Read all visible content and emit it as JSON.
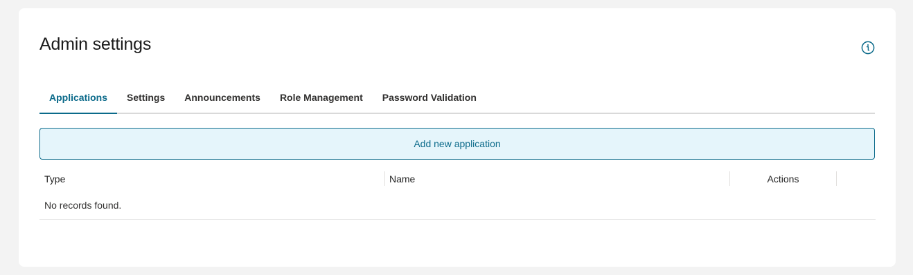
{
  "header": {
    "title": "Admin settings",
    "info_icon": "info-icon"
  },
  "tabs": [
    {
      "label": "Applications",
      "active": true
    },
    {
      "label": "Settings",
      "active": false
    },
    {
      "label": "Announcements",
      "active": false
    },
    {
      "label": "Role Management",
      "active": false
    },
    {
      "label": "Password Validation",
      "active": false
    }
  ],
  "add_button": {
    "label": "Add new application"
  },
  "table": {
    "columns": [
      "Type",
      "Name",
      "Actions"
    ],
    "empty_message": "No records found."
  },
  "colors": {
    "accent": "#0b6a8a",
    "button_bg": "#e5f5fb",
    "page_bg": "#f3f3f3",
    "card_bg": "#ffffff"
  }
}
